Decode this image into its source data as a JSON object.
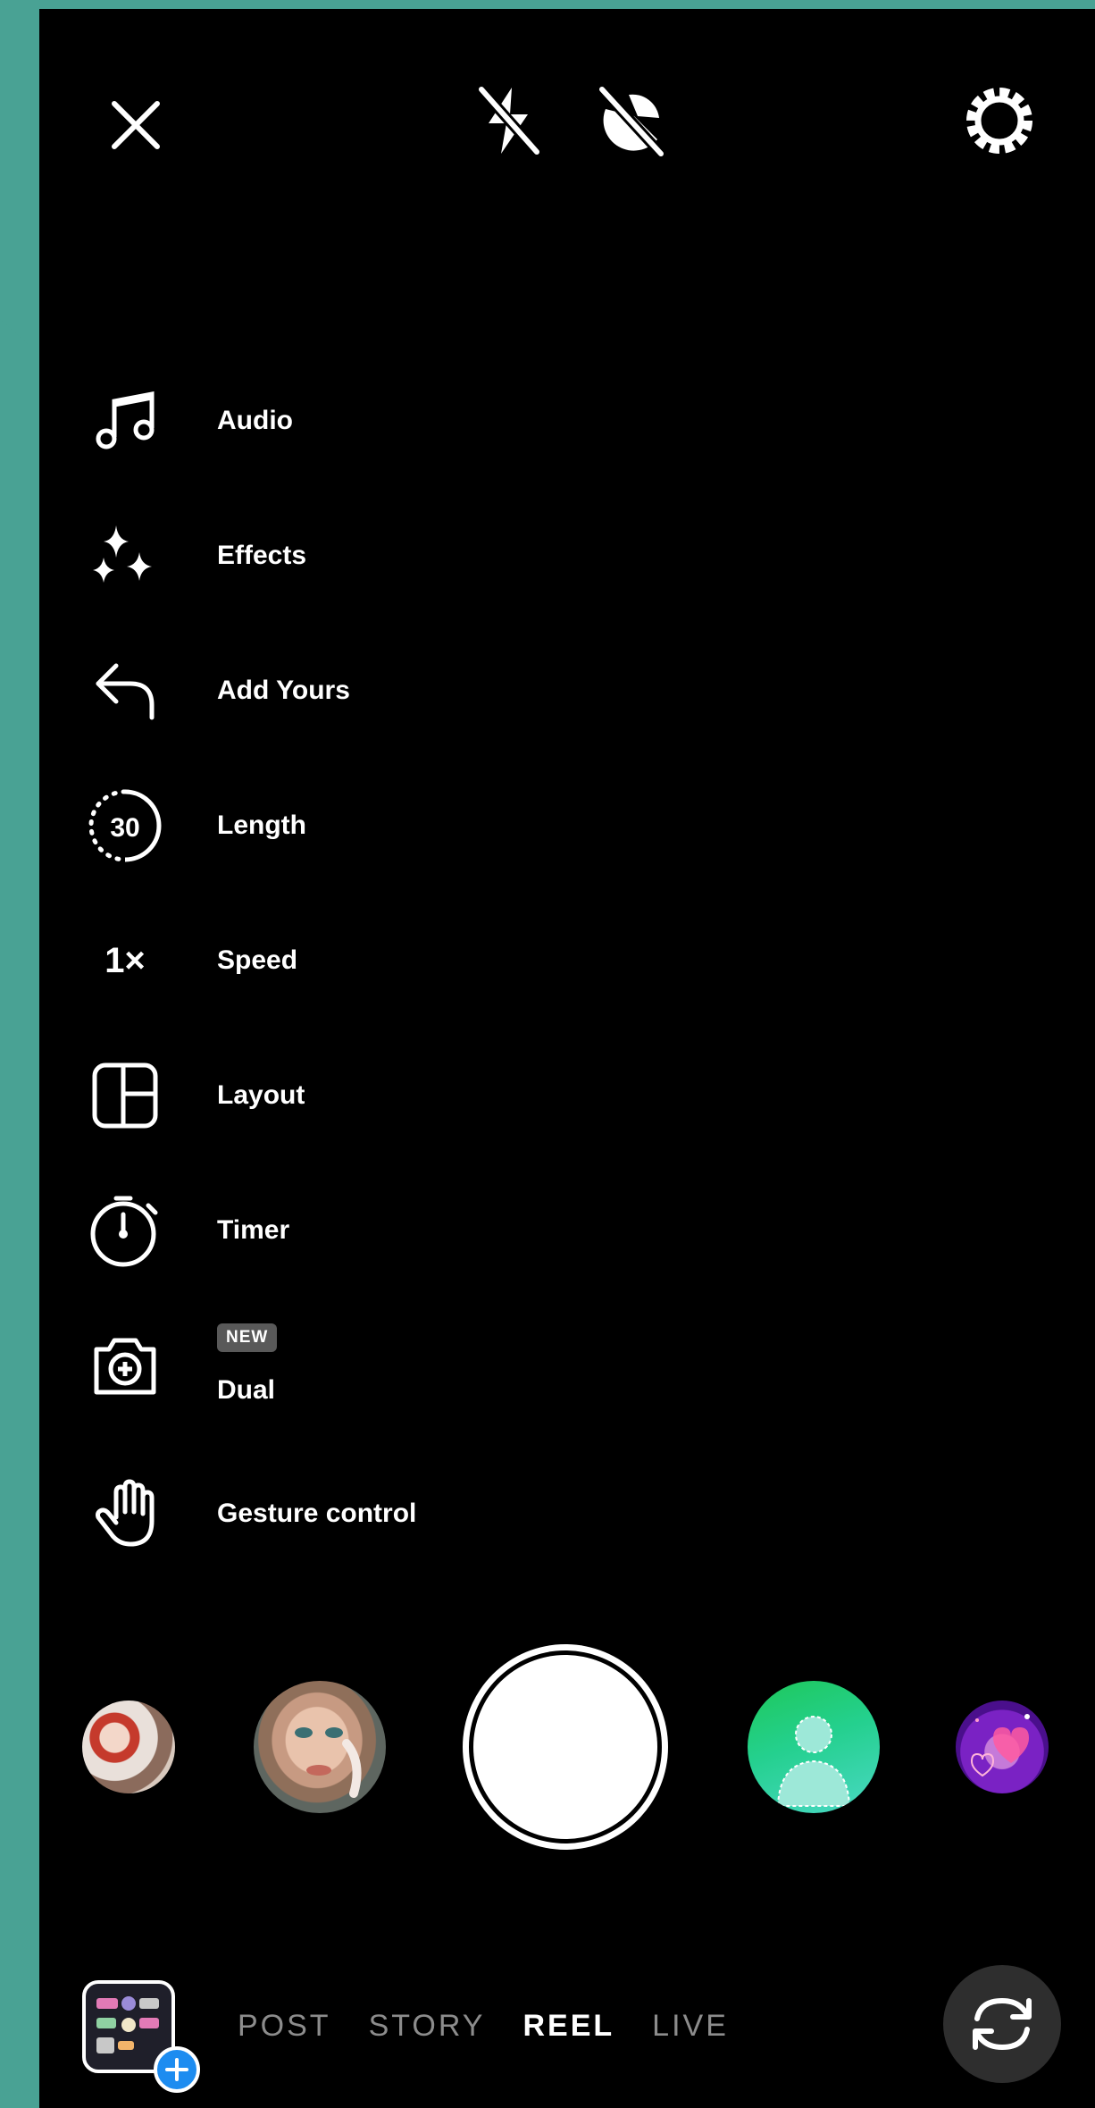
{
  "top_bar": {
    "close_icon": "close-icon",
    "flash_icon": "flash-off-icon",
    "night_icon": "night-mode-off-icon",
    "settings_icon": "gear-icon"
  },
  "menu": [
    {
      "label": "Audio",
      "icon": "music-note-icon"
    },
    {
      "label": "Effects",
      "icon": "sparkles-icon"
    },
    {
      "label": "Add Yours",
      "icon": "reply-arrow-icon"
    },
    {
      "label": "Length",
      "icon": "length-30-icon",
      "icon_text": "30"
    },
    {
      "label": "Speed",
      "icon": "speed-icon",
      "icon_text": "1×"
    },
    {
      "label": "Layout",
      "icon": "layout-grid-icon"
    },
    {
      "label": "Timer",
      "icon": "stopwatch-icon"
    },
    {
      "label": "Dual",
      "icon": "dual-camera-icon",
      "badge": "NEW"
    },
    {
      "label": "Gesture control",
      "icon": "hand-icon"
    }
  ],
  "effects_tray": [
    {
      "name": "products-effect-thumbnail"
    },
    {
      "name": "face-effect-thumbnail"
    },
    {
      "name": "green-screen-effect-thumbnail"
    },
    {
      "name": "hearts-effect-thumbnail"
    }
  ],
  "modes": [
    {
      "label": "POST",
      "active": false
    },
    {
      "label": "STORY",
      "active": false
    },
    {
      "label": "REEL",
      "active": true
    },
    {
      "label": "LIVE",
      "active": false
    }
  ],
  "colors": {
    "background_frame": "#49a294",
    "screen": "#000000",
    "badge": "#595959",
    "inactive_mode": "#8c8c8c",
    "add_button": "#1d8cf0"
  }
}
